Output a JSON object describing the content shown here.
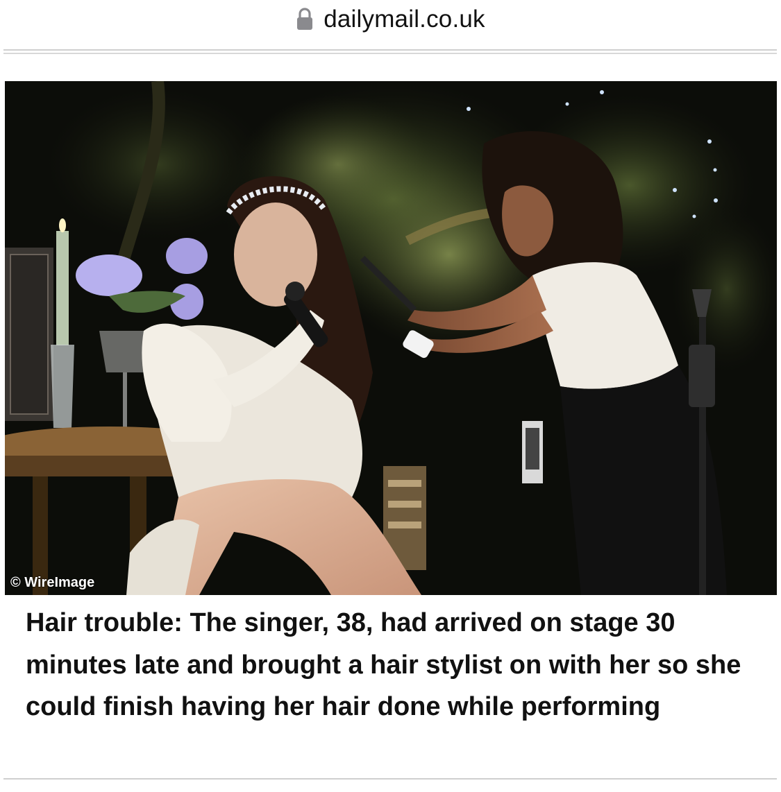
{
  "browser": {
    "url": "dailymail.co.uk",
    "lock_icon": "lock-icon"
  },
  "article": {
    "photo_credit": "© WireImage",
    "caption": "Hair trouble: The singer, 38, had arrived on stage 30 minutes late and brought a hair stylist on with her so she could finish having her hair done while performing"
  },
  "colors": {
    "text": "#111111",
    "rule": "#cfcfcf",
    "photo_background": "#0b0c08"
  }
}
